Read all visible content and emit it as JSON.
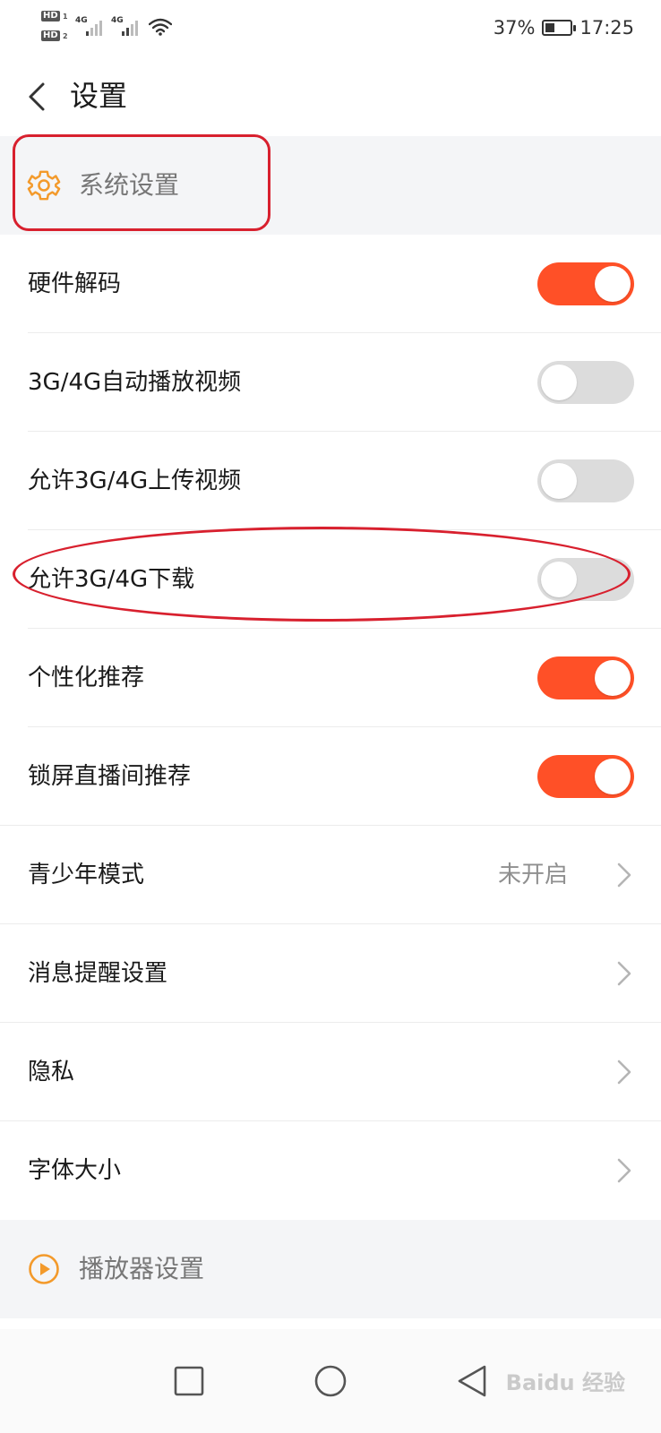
{
  "status_bar": {
    "hd1": "HD",
    "hd1_sub": "1",
    "hd2": "HD",
    "hd2_sub": "2",
    "net1": "4G",
    "net2": "4G",
    "battery_percent": "37%",
    "battery_level": 0.37,
    "time": "17:25"
  },
  "header": {
    "title": "设置",
    "back_icon": "chevron-left-icon"
  },
  "sections": {
    "system": {
      "label": "系统设置",
      "icon": "gear-icon",
      "color": "#f39a2b"
    },
    "player": {
      "label": "播放器设置",
      "icon": "play-circle-icon",
      "color": "#f39a2b"
    }
  },
  "rows": [
    {
      "label": "硬件解码",
      "toggle": true
    },
    {
      "label": "3G/4G自动播放视频",
      "toggle": false
    },
    {
      "label": "允许3G/4G上传视频",
      "toggle": false
    },
    {
      "label": "允许3G/4G下载",
      "toggle": false
    },
    {
      "label": "个性化推荐",
      "toggle": true
    },
    {
      "label": "锁屏直播间推荐",
      "toggle": true
    }
  ],
  "nav_rows": [
    {
      "label": "青少年模式",
      "value": "未开启"
    },
    {
      "label": "消息提醒设置"
    },
    {
      "label": "隐私"
    },
    {
      "label": "字体大小"
    }
  ],
  "nav_bar": {
    "recent_icon": "square-icon",
    "home_icon": "circle-icon",
    "back_icon": "triangle-back-icon",
    "watermark": "Baidu 经验"
  },
  "colors": {
    "toggle_on": "#ff5027",
    "toggle_off": "#dcdcdc",
    "accent": "#f39a2b",
    "highlight": "#d8202e"
  }
}
